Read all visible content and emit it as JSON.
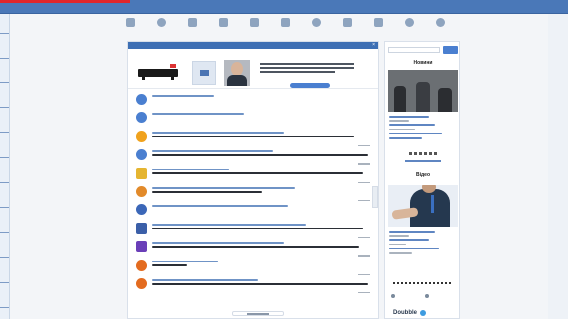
{
  "topnav": {
    "brand": "",
    "menu": [
      "",
      "",
      "",
      "",
      ""
    ],
    "right": [
      "",
      ""
    ]
  },
  "toolbar": {
    "items": [
      {
        "label": "",
        "icon": "camera-icon"
      },
      {
        "label": "",
        "icon": "share-icon"
      },
      {
        "label": "",
        "icon": "list-icon"
      },
      {
        "label": "",
        "icon": "image-icon"
      },
      {
        "label": "",
        "icon": "chart-icon"
      },
      {
        "label": "",
        "icon": "monitor-icon"
      },
      {
        "label": "",
        "icon": "cloud-icon"
      },
      {
        "label": "",
        "icon": "copy-icon"
      },
      {
        "label": "",
        "icon": "box-icon"
      },
      {
        "label": "",
        "icon": "settings-icon"
      },
      {
        "label": "",
        "icon": "help-icon"
      }
    ]
  },
  "notice": {
    "text": "",
    "close": "×"
  },
  "feed": {
    "items": [
      {
        "icon": "user-icon",
        "color": "#4a7fd0"
      },
      {
        "icon": "check-icon",
        "color": "#4a7fd0"
      },
      {
        "icon": "warning-icon",
        "color": "#f0a21d"
      },
      {
        "icon": "chat-icon",
        "color": "#4a7fd0"
      },
      {
        "icon": "edit-icon",
        "color": "#e5b531"
      },
      {
        "icon": "users-icon",
        "color": "#e28a2a"
      },
      {
        "icon": "star-icon",
        "color": "#3b67b8"
      },
      {
        "icon": "office-icon",
        "color": "#3b5fa8"
      },
      {
        "icon": "visualstudio-icon",
        "color": "#6a3fb8"
      },
      {
        "icon": "user-add-icon",
        "color": "#e36b1f"
      },
      {
        "icon": "user-icon",
        "color": "#e36b1f"
      }
    ]
  },
  "sidebar": {
    "search_placeholder": "",
    "section_news": "Новини",
    "section_video": "Відео",
    "bottom_label": "Doubble"
  },
  "colors": {
    "nav": "#4a78b8",
    "accent": "#4a7fd0",
    "red_mark": "#e0262b"
  }
}
